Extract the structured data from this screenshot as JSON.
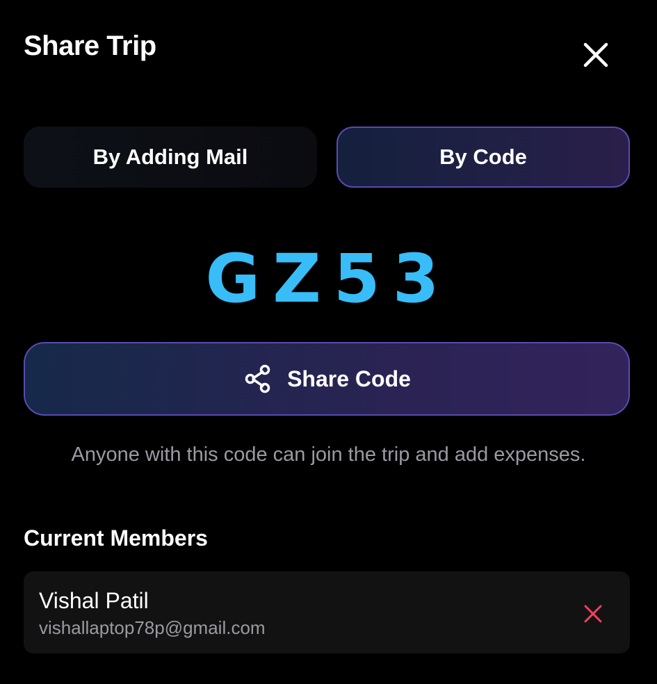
{
  "header": {
    "title": "Share Trip"
  },
  "tabs": [
    {
      "label": "By Adding Mail",
      "active": false
    },
    {
      "label": "By Code",
      "active": true
    }
  ],
  "code": {
    "value": "GZ53"
  },
  "share_button": {
    "label": "Share Code"
  },
  "hint": "Anyone with this code can join the trip and add expenses.",
  "members": {
    "heading": "Current Members",
    "list": [
      {
        "name": "Vishal Patil",
        "email": "vishallaptop78p@gmail.com"
      }
    ]
  },
  "colors": {
    "accent_code": "#38bdf8",
    "active_border": "#5a4bb0",
    "remove": "#f43f5e",
    "muted_text": "#9a9aa3"
  }
}
